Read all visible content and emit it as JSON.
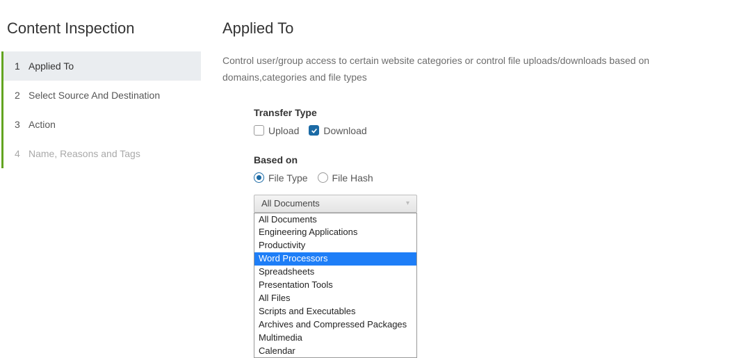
{
  "sidebar": {
    "title": "Content Inspection",
    "steps": [
      {
        "num": "1",
        "label": "Applied To",
        "state": "active"
      },
      {
        "num": "2",
        "label": "Select Source And Destination",
        "state": "normal"
      },
      {
        "num": "3",
        "label": "Action",
        "state": "normal"
      },
      {
        "num": "4",
        "label": "Name, Reasons and Tags",
        "state": "disabled"
      }
    ]
  },
  "main": {
    "title": "Applied To",
    "description": "Control user/group access to certain website categories or control file uploads/downloads based on domains,categories and file types",
    "transfer": {
      "label": "Transfer Type",
      "upload": {
        "label": "Upload",
        "checked": false
      },
      "download": {
        "label": "Download",
        "checked": true
      }
    },
    "basedon": {
      "label": "Based on",
      "filetype": {
        "label": "File Type",
        "selected": true
      },
      "filehash": {
        "label": "File Hash",
        "selected": false
      }
    },
    "select": {
      "value": "All Documents",
      "options": [
        {
          "label": "All Documents",
          "highlight": false
        },
        {
          "label": "Engineering Applications",
          "highlight": false
        },
        {
          "label": "Productivity",
          "highlight": false
        },
        {
          "label": "Word Processors",
          "highlight": true
        },
        {
          "label": "Spreadsheets",
          "highlight": false
        },
        {
          "label": "Presentation Tools",
          "highlight": false
        },
        {
          "label": "All Files",
          "highlight": false
        },
        {
          "label": "Scripts and Executables",
          "highlight": false
        },
        {
          "label": "Archives and Compressed Packages",
          "highlight": false
        },
        {
          "label": "Multimedia",
          "highlight": false
        },
        {
          "label": "Calendar",
          "highlight": false
        }
      ]
    }
  }
}
